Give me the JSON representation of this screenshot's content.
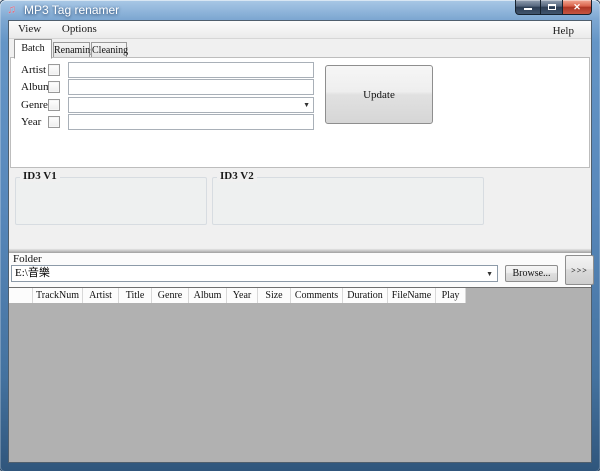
{
  "window": {
    "title": "MP3 Tag renamer"
  },
  "icons": {
    "app": "♫",
    "close": "✕",
    "dropdown": "▼"
  },
  "menu": {
    "view": "View",
    "options": "Options",
    "help": "Help"
  },
  "tabs": {
    "batch": "Batch",
    "renaming": "Renaming",
    "cleaning": "Cleaning"
  },
  "batch": {
    "fields": [
      {
        "label": "Artist",
        "value": ""
      },
      {
        "label": "Album",
        "value": ""
      },
      {
        "label": "Genre",
        "value": ""
      },
      {
        "label": "Year",
        "value": ""
      }
    ],
    "update_label": "Update"
  },
  "id3": {
    "v1_label": "ID3 V1",
    "v2_label": "ID3 V2"
  },
  "folder": {
    "label": "Folder",
    "path": "E:\\音樂",
    "browse_label": "Browse...",
    "expand_label": ">>>"
  },
  "table": {
    "columns": [
      "",
      "TrackNum",
      "Artist",
      "Title",
      "Genre",
      "Album",
      "Year",
      "Size",
      "Comments",
      "Duration",
      "FileName",
      "Play"
    ],
    "rows": []
  },
  "colors": {
    "titlebar_blue": "#5787ba",
    "list_background": "#b1b1b1",
    "close_button_red": "#c65540",
    "app_icon_pink": "#e06a80"
  }
}
